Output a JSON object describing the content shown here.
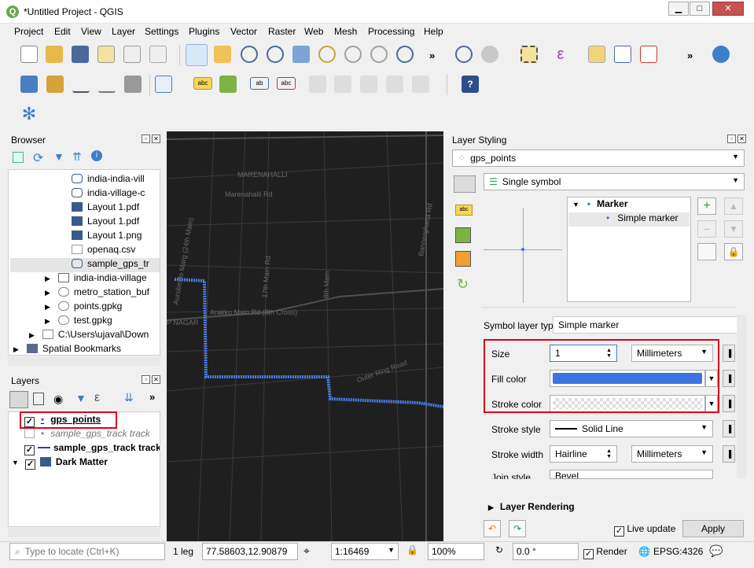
{
  "window": {
    "title": "*Untitled Project - QGIS"
  },
  "menu": [
    "Project",
    "Edit",
    "View",
    "Layer",
    "Settings",
    "Plugins",
    "Vector",
    "Raster",
    "Web",
    "Mesh",
    "Processing",
    "Help"
  ],
  "browser": {
    "title": "Browser",
    "items": [
      "india-india-vill",
      "india-village-c",
      "Layout 1.pdf",
      "Layout 1.pdf",
      "Layout 1.png",
      "openaq.csv",
      "sample_gps_tr",
      "india-india-village",
      "metro_station_buf",
      "points.gpkg",
      "test.gpkg",
      "C:\\Users\\ujaval\\Down",
      "Spatial Bookmarks"
    ]
  },
  "layers": {
    "title": "Layers",
    "items": [
      "gps_points",
      "sample_gps_track track",
      "sample_gps_track track",
      "Dark Matter"
    ]
  },
  "map": {
    "labels": [
      "MARENAHALLI",
      "Marenahalli Rd",
      "P NAGAR",
      "Arakku Main Rd (8th Cross)",
      "Outer Ring Road",
      "Bannerghatta Rd",
      "17th Main Rd",
      "8th Main",
      "Aurobindo Marg (24th Main)"
    ]
  },
  "styling": {
    "title": "Layer Styling",
    "layer": "gps_points",
    "renderer": "Single symbol",
    "tree_marker": "Marker",
    "tree_simple": "Simple marker",
    "symbol_layer_type_label": "Symbol layer type",
    "symbol_layer_type": "Simple marker",
    "size_label": "Size",
    "size_value": "1",
    "size_unit": "Millimeters",
    "fill_label": "Fill color",
    "fill_color": "#3b73e0",
    "stroke_label": "Stroke color",
    "stroke_style_label": "Stroke style",
    "stroke_style": "Solid Line",
    "stroke_width_label": "Stroke width",
    "stroke_width": "Hairline",
    "stroke_width_unit": "Millimeters",
    "join_label": "Join style",
    "join": "Bevel",
    "rendering": "Layer Rendering",
    "live_update": "Live update",
    "apply": "Apply"
  },
  "status": {
    "locate_placeholder": "Type to locate (Ctrl+K)",
    "legend": "1 leg",
    "coord": "77.58603,12.90879",
    "scale": "1:16469",
    "magnifier": "100%",
    "rotation": "0.0 °",
    "render": "Render",
    "crs": "EPSG:4326"
  }
}
